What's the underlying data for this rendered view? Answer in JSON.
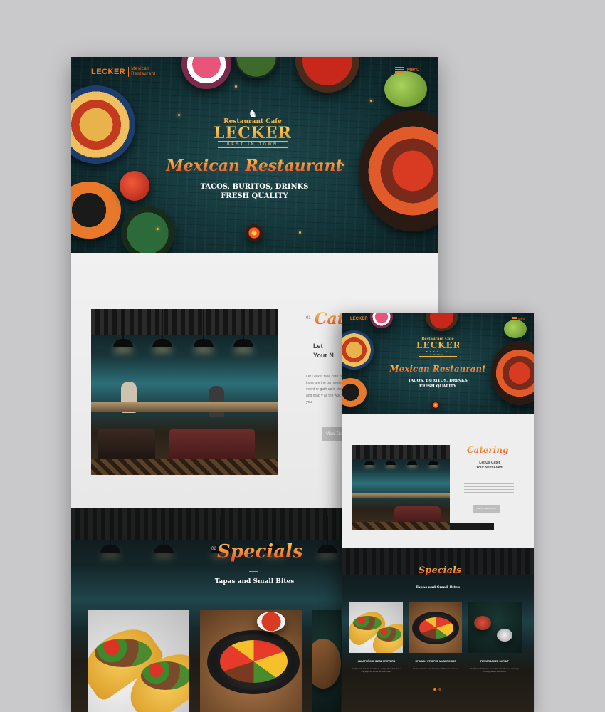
{
  "brand": {
    "name": "LECKER",
    "tagline_line1": "Mexican",
    "tagline_line2": "Restaurant",
    "menu_label": "Menu"
  },
  "logo": {
    "cafe": "Restaurant Cafe",
    "name": "LECKER",
    "best": "BEST IN TOWN"
  },
  "hero": {
    "title": "Mexican Restaurant",
    "sub_line1": "TACOS, BURITOS, DRINKS",
    "sub_line2": "FRESH QUALITY"
  },
  "catering": {
    "number": "01",
    "title": "Catering",
    "title_partial": "Cate",
    "subtitle": "Let Us Cater\nYour Next Event",
    "subtitle_partial": "Let\nYour N",
    "body": "Let Lecker take care party trays are the pa meeting, event or gath up in store and grab y all the wok for you",
    "button": "View Our Catering Menu",
    "button_partial": "View Ou"
  },
  "specials": {
    "number": "02",
    "title": "Specials",
    "subtitle": "Tapas and Small Bites",
    "items": [
      {
        "name": "JALAPEÑO CHEESE FRITTERS",
        "desc": "Freshly made hand breaded fritters, oozing with melted cheese and jalapeno. Served with sour cream."
      },
      {
        "name": "SPINACH STUFFED MUSHROOMS",
        "desc": "Fresh mushrooms caps filled with rich Parmesan cheese."
      },
      {
        "name": "FIRECRACKER SHRIMP",
        "desc": "Fresh Gulf shrimp tossed in a chile aioli with sweet and tangy dressing, served over lettuce."
      }
    ]
  },
  "colors": {
    "accent": "#f47a1f",
    "gold": "#f5b544",
    "teal": "#123236"
  }
}
